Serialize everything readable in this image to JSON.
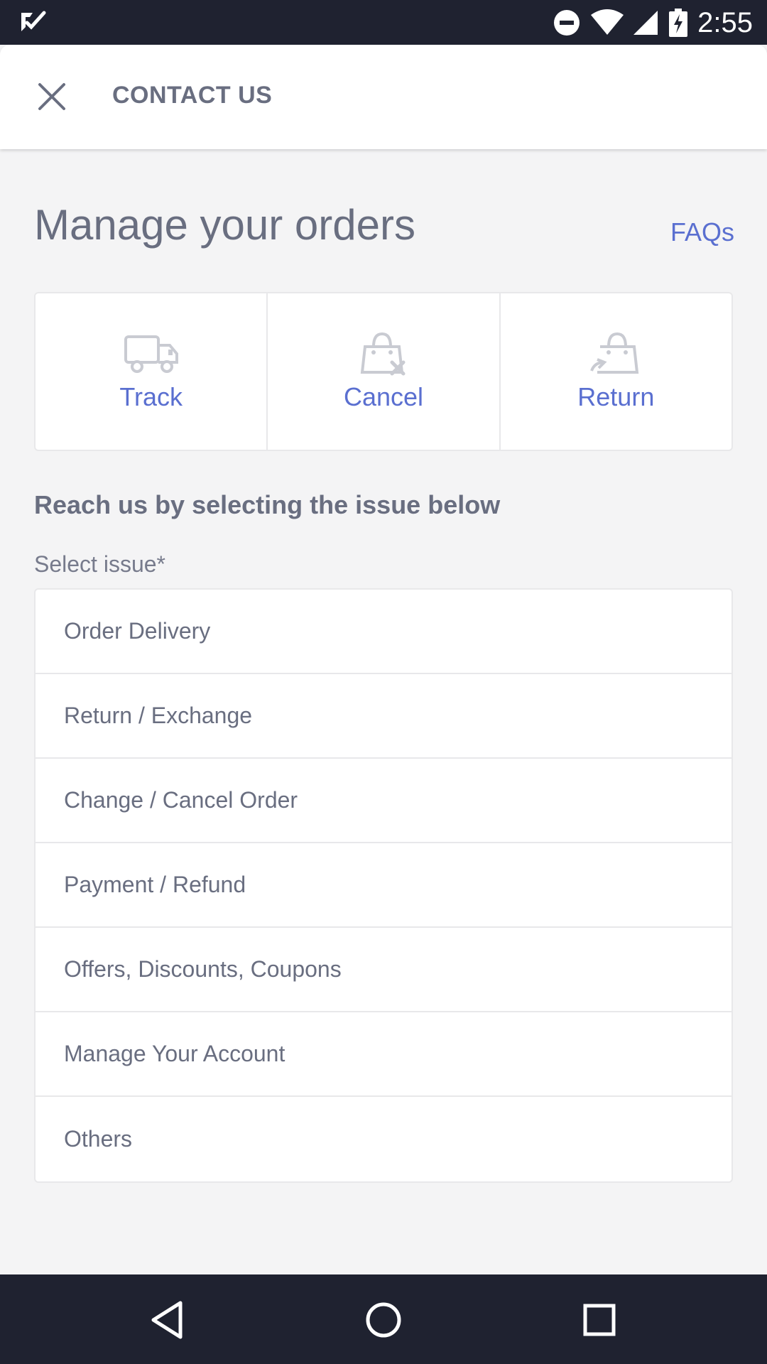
{
  "status_bar": {
    "time": "2:55",
    "icons": [
      "app-check-icon",
      "do-not-disturb-icon",
      "wifi-icon",
      "cellular-signal-icon",
      "battery-charging-icon"
    ]
  },
  "header": {
    "title": "CONTACT US",
    "close_icon": "close-icon"
  },
  "main": {
    "title": "Manage your orders",
    "faqs_link": "FAQs",
    "actions": [
      {
        "label": "Track",
        "icon": "truck-icon"
      },
      {
        "label": "Cancel",
        "icon": "bag-cancel-icon"
      },
      {
        "label": "Return",
        "icon": "bag-return-icon"
      }
    ],
    "reach_heading": "Reach us by selecting the issue below",
    "select_label": "Select issue*",
    "issues": [
      "Order Delivery",
      "Return / Exchange",
      "Change / Cancel Order",
      "Payment / Refund",
      "Offers, Discounts, Coupons",
      "Manage Your Account",
      "Others"
    ]
  },
  "nav_bar": {
    "icons": [
      "back-icon",
      "home-icon",
      "recents-icon"
    ]
  },
  "colors": {
    "accent": "#5a6fd0",
    "text": "#696e80",
    "background": "#f4f4f5",
    "bars": "#1f2230"
  }
}
